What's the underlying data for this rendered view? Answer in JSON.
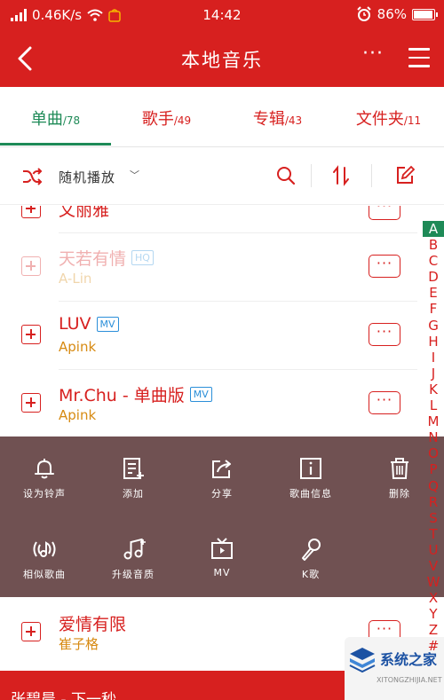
{
  "status": {
    "speed": "0.46K/s",
    "time": "14:42",
    "battery": "86%"
  },
  "header": {
    "title": "本地音乐",
    "more": "···"
  },
  "tabs": [
    {
      "label": "单曲",
      "count": "/78",
      "active": true
    },
    {
      "label": "歌手",
      "count": "/49"
    },
    {
      "label": "专辑",
      "count": "/43"
    },
    {
      "label": "文件夹",
      "count": "/11"
    }
  ],
  "toolbar": {
    "shuffle_label": "随机播放",
    "caret": "﹀"
  },
  "songs": [
    {
      "name": "文丽雅",
      "artist": ""
    },
    {
      "name": "天若有情",
      "badge": "HQ",
      "artist": "A-Lin"
    },
    {
      "name": "LUV",
      "badge": "MV",
      "artist": "Apink"
    },
    {
      "name": "Mr.Chu - 单曲版",
      "badge": "MV",
      "artist": "Apink"
    },
    {
      "name": "爱情有限",
      "artist": "崔子格"
    }
  ],
  "more_button": "···",
  "actions_row1": [
    {
      "label": "设为铃声",
      "icon": "bell-icon"
    },
    {
      "label": "添加",
      "icon": "add-to-list-icon"
    },
    {
      "label": "分享",
      "icon": "share-icon"
    },
    {
      "label": "歌曲信息",
      "icon": "info-icon"
    },
    {
      "label": "删除",
      "icon": "trash-icon"
    }
  ],
  "actions_row2": [
    {
      "label": "相似歌曲",
      "icon": "similar-songs-icon"
    },
    {
      "label": "升级音质",
      "icon": "music-note-icon"
    },
    {
      "label": "MV",
      "icon": "tv-icon"
    },
    {
      "label": "K歌",
      "icon": "microphone-icon"
    }
  ],
  "index": [
    "A",
    "B",
    "C",
    "D",
    "E",
    "F",
    "G",
    "H",
    "I",
    "J",
    "K",
    "L",
    "M",
    "N",
    "O",
    "P",
    "Q",
    "R",
    "S",
    "T",
    "U",
    "V",
    "W",
    "X",
    "Y",
    "Z",
    "#"
  ],
  "now_playing": {
    "text": "张碧晨 - 下一秒"
  },
  "watermark": {
    "brand": "系统之家",
    "url": "XITONGZHIJIA.NET"
  },
  "colors": {
    "accent": "#d7201f",
    "active_tab": "#1e8a57",
    "artist": "#d78a12",
    "badge": "#2b8fd9",
    "popup_bg": "#705152"
  }
}
